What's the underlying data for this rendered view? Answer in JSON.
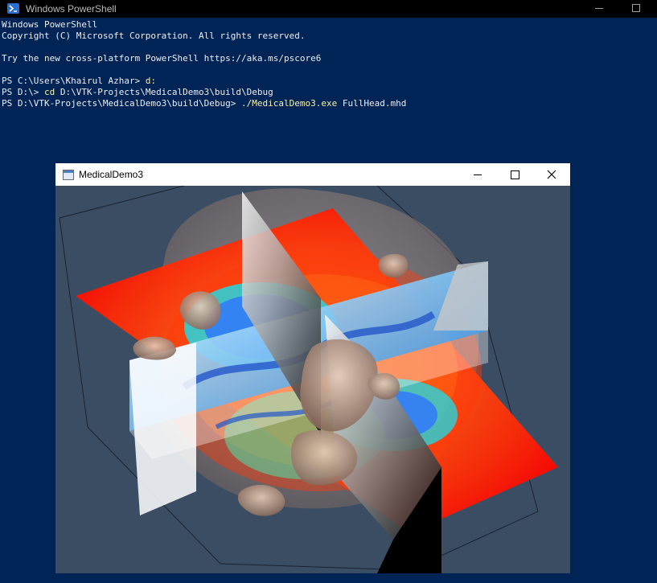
{
  "powershell": {
    "title": "Windows PowerShell",
    "lines": [
      {
        "parts": [
          {
            "text": "Windows PowerShell",
            "color": "#eeedf0"
          }
        ]
      },
      {
        "parts": [
          {
            "text": "Copyright (C) Microsoft Corporation. All rights reserved.",
            "color": "#eeedf0"
          }
        ]
      },
      {
        "parts": []
      },
      {
        "parts": [
          {
            "text": "Try the new cross-platform PowerShell https://aka.ms/pscore6",
            "color": "#eeedf0"
          }
        ]
      },
      {
        "parts": []
      },
      {
        "parts": [
          {
            "text": "PS C:\\Users\\Khairul Azhar> ",
            "color": "#eeedf0"
          },
          {
            "text": "d:",
            "color": "#f9f1a5"
          }
        ]
      },
      {
        "parts": [
          {
            "text": "PS D:\\> ",
            "color": "#eeedf0"
          },
          {
            "text": "cd",
            "color": "#f9f1a5"
          },
          {
            "text": " D:\\VTK-Projects\\MedicalDemo3\\build\\Debug",
            "color": "#eeedf0"
          }
        ]
      },
      {
        "parts": [
          {
            "text": "PS D:\\VTK-Projects\\MedicalDemo3\\build\\Debug> ",
            "color": "#eeedf0"
          },
          {
            "text": "./MedicalDemo3.exe",
            "color": "#f9f1a5"
          },
          {
            "text": " FullHead.mhd",
            "color": "#eeedf0"
          }
        ]
      }
    ]
  },
  "demo_window": {
    "title": "MedicalDemo3",
    "background": "#3b4d63"
  },
  "icons": {
    "powershell": "powershell-icon",
    "minimize": "minimize-icon",
    "maximize": "maximize-icon",
    "close": "close-icon",
    "app": "app-window-icon"
  }
}
